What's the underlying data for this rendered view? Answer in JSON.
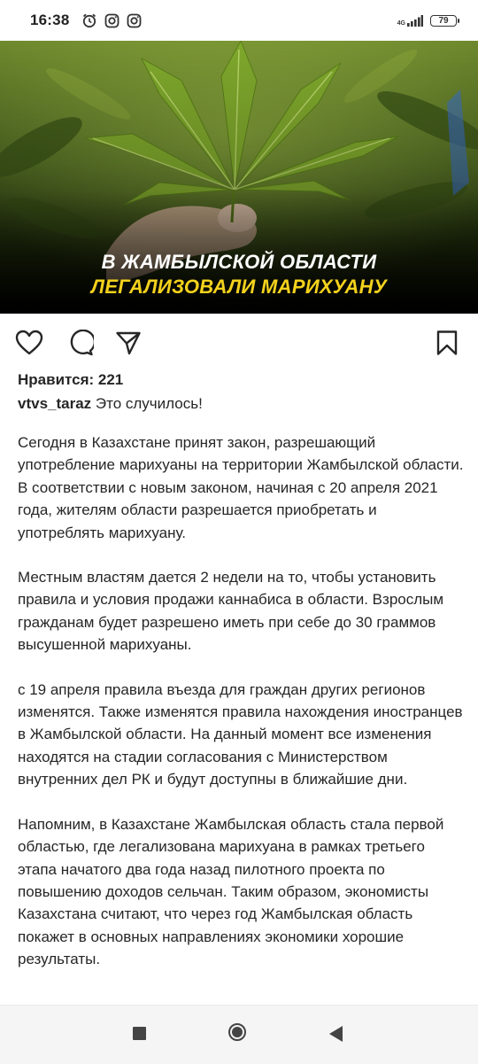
{
  "status_bar": {
    "time": "16:38",
    "network": "4G",
    "battery": "79",
    "icons": [
      "alarm-icon",
      "instagram-icon",
      "instagram-icon"
    ]
  },
  "post_image": {
    "headline_line1": "В ЖАМБЫЛСКОЙ ОБЛАСТИ",
    "headline_line2": "ЛЕГАЛИЗОВАЛИ МАРИХУАНУ",
    "headline_color1": "#ffffff",
    "headline_color2": "#f4d21c"
  },
  "actions": [
    "heart-icon",
    "comment-icon",
    "share-icon",
    "bookmark-icon"
  ],
  "post": {
    "likes": "Нравится: 221",
    "username": "vtvs_taraz",
    "caption": " Это случилось!",
    "paragraphs": [
      "Сегодня в Казахстане принят закон, разрешающий употребление марихуаны на территории Жамбылской области. В соответствии с новым законом, начиная с 20 апреля 2021 года, жителям области разрешается приобретать и употреблять марихуану.",
      "Местным властям дается 2 недели на то, чтобы установить правила и условия продажи каннабиса в области. Взрослым гражданам будет разрешено иметь при себе до 30 граммов высушенной марихуаны.",
      "с 19 апреля правила въезда для граждан других регионов изменятся. Также изменятся правила нахождения иностранцев в Жамбылской области. На данный момент все изменения находятся на стадии согласования с Министерством внутренних дел РК и будут доступны в ближайшие дни.",
      "Напомним, в Казахстане Жамбылская область стала первой областью, где легализована марихуана в рамках третьего этапа начатого два года назад пилотного проекта по повышению доходов сельчан. Таким образом, экономисты Казахстана считают, что через год Жамбылская область покажет в основных направлениях экономики хорошие результаты."
    ]
  },
  "nav": [
    "recents-button",
    "home-button",
    "back-button"
  ]
}
